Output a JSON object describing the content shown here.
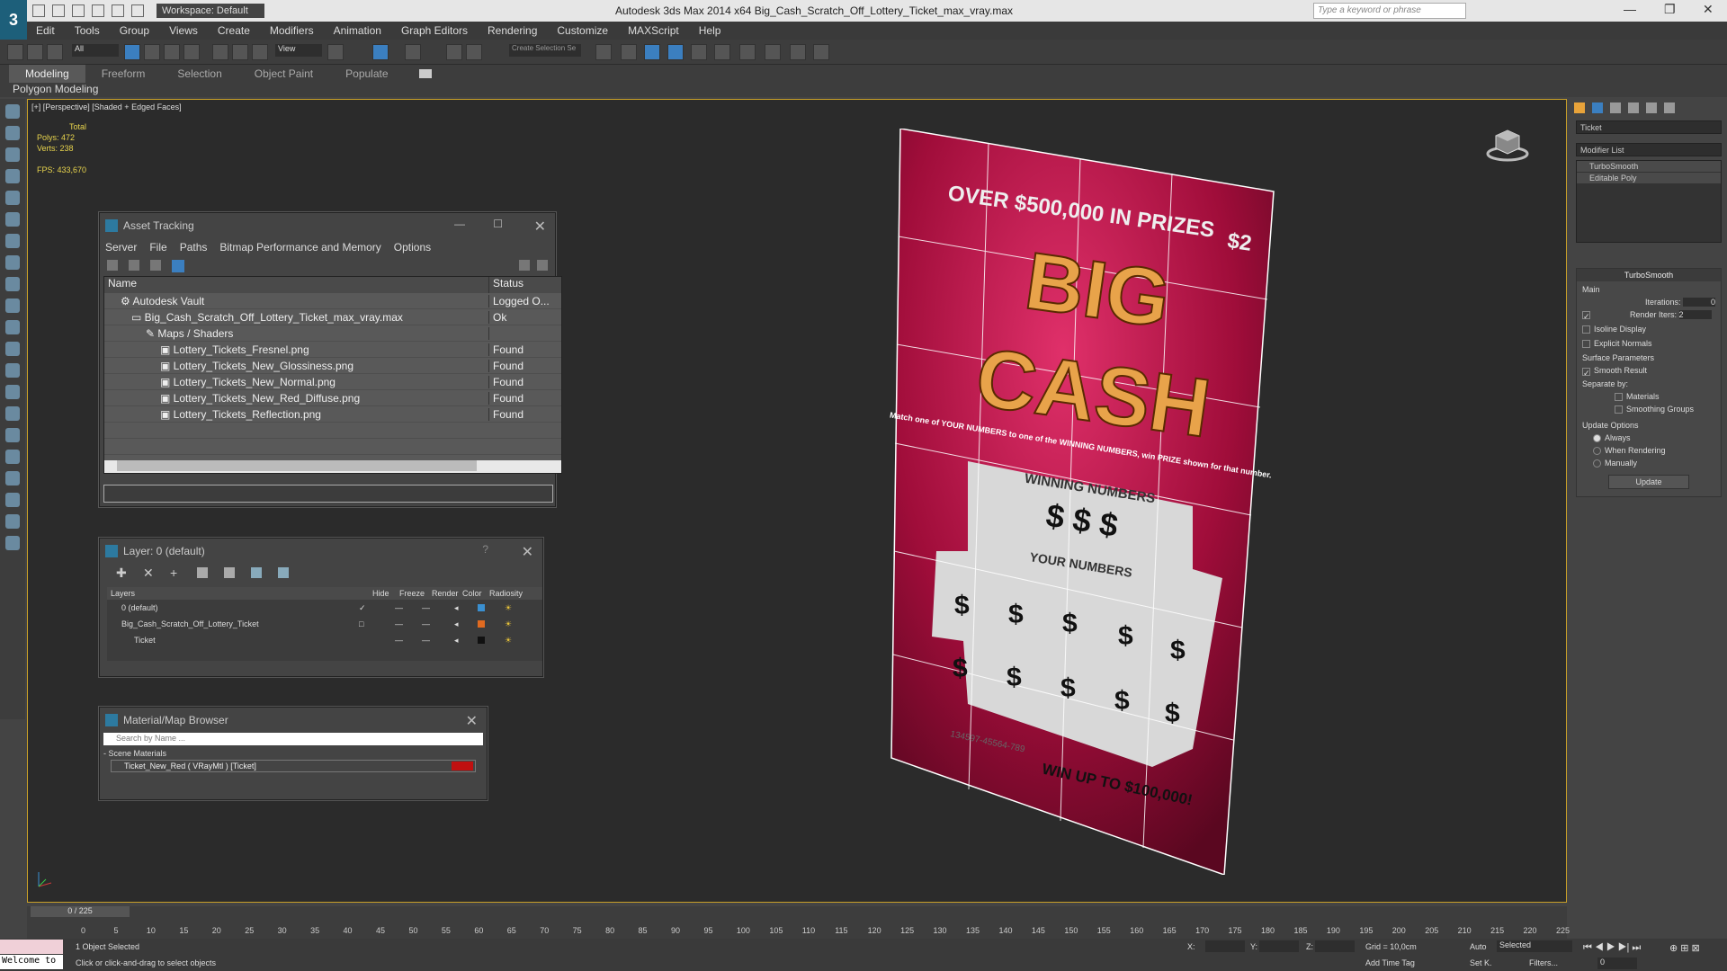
{
  "app": {
    "logo": "3",
    "workspace": "Workspace: Default",
    "title": "Autodesk 3ds Max  2014 x64     Big_Cash_Scratch_Off_Lottery_Ticket_max_vray.max",
    "search_placeholder": "Type a keyword or phrase"
  },
  "menu": [
    "Edit",
    "Tools",
    "Group",
    "Views",
    "Create",
    "Modifiers",
    "Animation",
    "Graph Editors",
    "Rendering",
    "Customize",
    "MAXScript",
    "Help"
  ],
  "toolbar": {
    "filter": "All",
    "refcoord": "View",
    "selset": "Create Selection Se"
  },
  "ribbon": {
    "tabs": [
      "Modeling",
      "Freeform",
      "Selection",
      "Object Paint",
      "Populate"
    ],
    "sub": "Polygon Modeling"
  },
  "viewport": {
    "label": "[+] [Perspective] [Shaded + Edged Faces]",
    "stats": {
      "total": "Total",
      "polys": "Polys:  472",
      "verts": "Verts:  238",
      "fps": "FPS:      433,670"
    }
  },
  "ticket": {
    "top": "OVER $500,000 IN PRIZES",
    "price": "$2",
    "big": "BIG",
    "cash": "CASH",
    "instr": "Match one of YOUR NUMBERS to one of the WINNING NUMBERS, win PRIZE shown for that number.",
    "winning": "WINNING NUMBERS",
    "your": "YOUR NUMBERS",
    "prize": "PRIZE",
    "serial": "134597-45564-789",
    "winup": "WIN UP TO $100,000!"
  },
  "asset": {
    "title": "Asset Tracking",
    "menu": [
      "Server",
      "File",
      "Paths",
      "Bitmap Performance and Memory",
      "Options"
    ],
    "col_name": "Name",
    "col_status": "Status",
    "rows": [
      {
        "name": "Autodesk Vault",
        "status": "Logged O..."
      },
      {
        "name": "Big_Cash_Scratch_Off_Lottery_Ticket_max_vray.max",
        "status": "Ok"
      },
      {
        "name": "Maps / Shaders",
        "status": ""
      },
      {
        "name": "Lottery_Tickets_Fresnel.png",
        "status": "Found"
      },
      {
        "name": "Lottery_Tickets_New_Glossiness.png",
        "status": "Found"
      },
      {
        "name": "Lottery_Tickets_New_Normal.png",
        "status": "Found"
      },
      {
        "name": "Lottery_Tickets_New_Red_Diffuse.png",
        "status": "Found"
      },
      {
        "name": "Lottery_Tickets_Reflection.png",
        "status": "Found"
      }
    ]
  },
  "layer": {
    "title": "Layer: 0 (default)",
    "help": "?",
    "cols": [
      "Layers",
      "Hide",
      "Freeze",
      "Render",
      "Color",
      "Radiosity"
    ],
    "rows": [
      {
        "name": "0 (default)",
        "color": "#3a8fd0"
      },
      {
        "name": "Big_Cash_Scratch_Off_Lottery_Ticket",
        "color": "#e06a20"
      },
      {
        "name": "Ticket",
        "color": "#111111"
      }
    ]
  },
  "matbrowser": {
    "title": "Material/Map Browser",
    "search": "Search by Name ...",
    "section": "- Scene Materials",
    "item": "Ticket_New_Red  ( VRayMtl )  [Ticket]"
  },
  "cmd": {
    "objname": "Ticket",
    "modlist": "Modifier List",
    "stack": [
      "TurboSmooth",
      "Editable Poly"
    ],
    "ts_title": "TurboSmooth",
    "main": "Main",
    "iter_label": "Iterations:",
    "iter": "0",
    "render_iters": "Render Iters:",
    "render_iters_val": "2",
    "isoline": "Isoline Display",
    "explicit": "Explicit Normals",
    "surface": "Surface Parameters",
    "smooth": "Smooth Result",
    "sepby": "Separate by:",
    "materials": "Materials",
    "smgroups": "Smoothing Groups",
    "update_opts": "Update Options",
    "always": "Always",
    "whenrender": "When Rendering",
    "manually": "Manually",
    "update": "Update"
  },
  "timeline": {
    "frame": "0 / 225",
    "ticks": [
      "0",
      "5",
      "10",
      "15",
      "20",
      "25",
      "30",
      "35",
      "40",
      "45",
      "50",
      "55",
      "60",
      "65",
      "70",
      "75",
      "80",
      "85",
      "90",
      "95",
      "100",
      "105",
      "110",
      "115",
      "120",
      "125",
      "130",
      "135",
      "140",
      "145",
      "150",
      "155",
      "160",
      "165",
      "170",
      "175",
      "180",
      "185",
      "190",
      "195",
      "200",
      "205",
      "210",
      "215",
      "220",
      "225"
    ]
  },
  "status": {
    "welcome": "Welcome to",
    "selected": "1 Object Selected",
    "hint": "Click or click-and-drag to select objects",
    "x": "X:",
    "y": "Y:",
    "z": "Z:",
    "grid": "Grid = 10,0cm",
    "addtag": "Add Time Tag",
    "auto": "Auto",
    "setk": "Set K.",
    "selected_dd": "Selected",
    "filters": "Filters...",
    "frame": "0"
  }
}
